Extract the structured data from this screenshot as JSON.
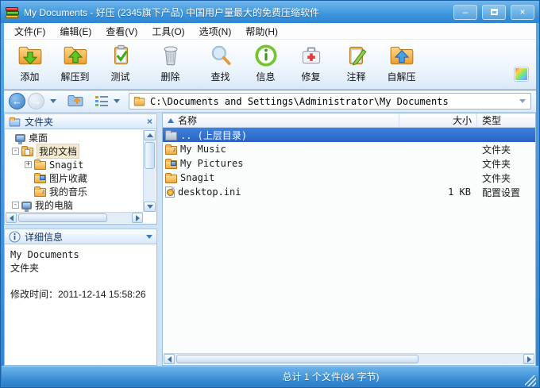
{
  "colors": {
    "title_blue": "#2e85d2",
    "selection_blue": "#2f6fd2",
    "panel_border": "#9ebdde",
    "status_blue": "#3488d2"
  },
  "window": {
    "title": "My Documents - 好压 (2345旗下产品) 中国用户量最大的免费压缩软件",
    "minimize": "–",
    "close": "×"
  },
  "menu": {
    "items": [
      "文件(F)",
      "编辑(E)",
      "查看(V)",
      "工具(O)",
      "选项(N)",
      "帮助(H)"
    ]
  },
  "toolbar": {
    "buttons": [
      {
        "label": "添加",
        "icon": "folder-arrow-down-icon"
      },
      {
        "label": "解压到",
        "icon": "folder-arrow-up-icon"
      },
      {
        "label": "测试",
        "icon": "clipboard-check-icon"
      },
      {
        "label": "删除",
        "icon": "trash-icon"
      },
      {
        "label": "查找",
        "icon": "magnifier-icon"
      },
      {
        "label": "信息",
        "icon": "info-circle-icon"
      },
      {
        "label": "修复",
        "icon": "repair-kit-icon"
      },
      {
        "label": "注释",
        "icon": "clipboard-pencil-icon"
      },
      {
        "label": "自解压",
        "icon": "folder-blue-arrow-up-icon"
      }
    ]
  },
  "nav": {
    "path": "C:\\Documents and Settings\\Administrator\\My Documents"
  },
  "panels": {
    "folders": {
      "title": "文件夹",
      "close": "×",
      "tree": [
        {
          "label": "桌面"
        },
        {
          "label": "我的文档",
          "expander": "-",
          "selected": true
        },
        {
          "label": "Snagit",
          "expander": "+"
        },
        {
          "label": "图片收藏"
        },
        {
          "label": "我的音乐"
        },
        {
          "label": "我的电脑",
          "expander": "-"
        }
      ]
    },
    "details": {
      "title": "详细信息",
      "name": "My Documents",
      "type": "文件夹",
      "modified": "修改时间：2011-12-14 15:58:26"
    }
  },
  "files": {
    "columns": [
      "名称",
      "大小",
      "类型"
    ],
    "rows": [
      {
        "name": ".. (上层目录)",
        "size": "",
        "type": "",
        "selected": true
      },
      {
        "name": "My Music",
        "size": "",
        "type": "文件夹"
      },
      {
        "name": "My Pictures",
        "size": "",
        "type": "文件夹"
      },
      {
        "name": "Snagit",
        "size": "",
        "type": "文件夹"
      },
      {
        "name": "desktop.ini",
        "size": "1 KB",
        "type": "配置设置"
      }
    ]
  },
  "status": {
    "total": "总计 1 个文件(84 字节)"
  }
}
